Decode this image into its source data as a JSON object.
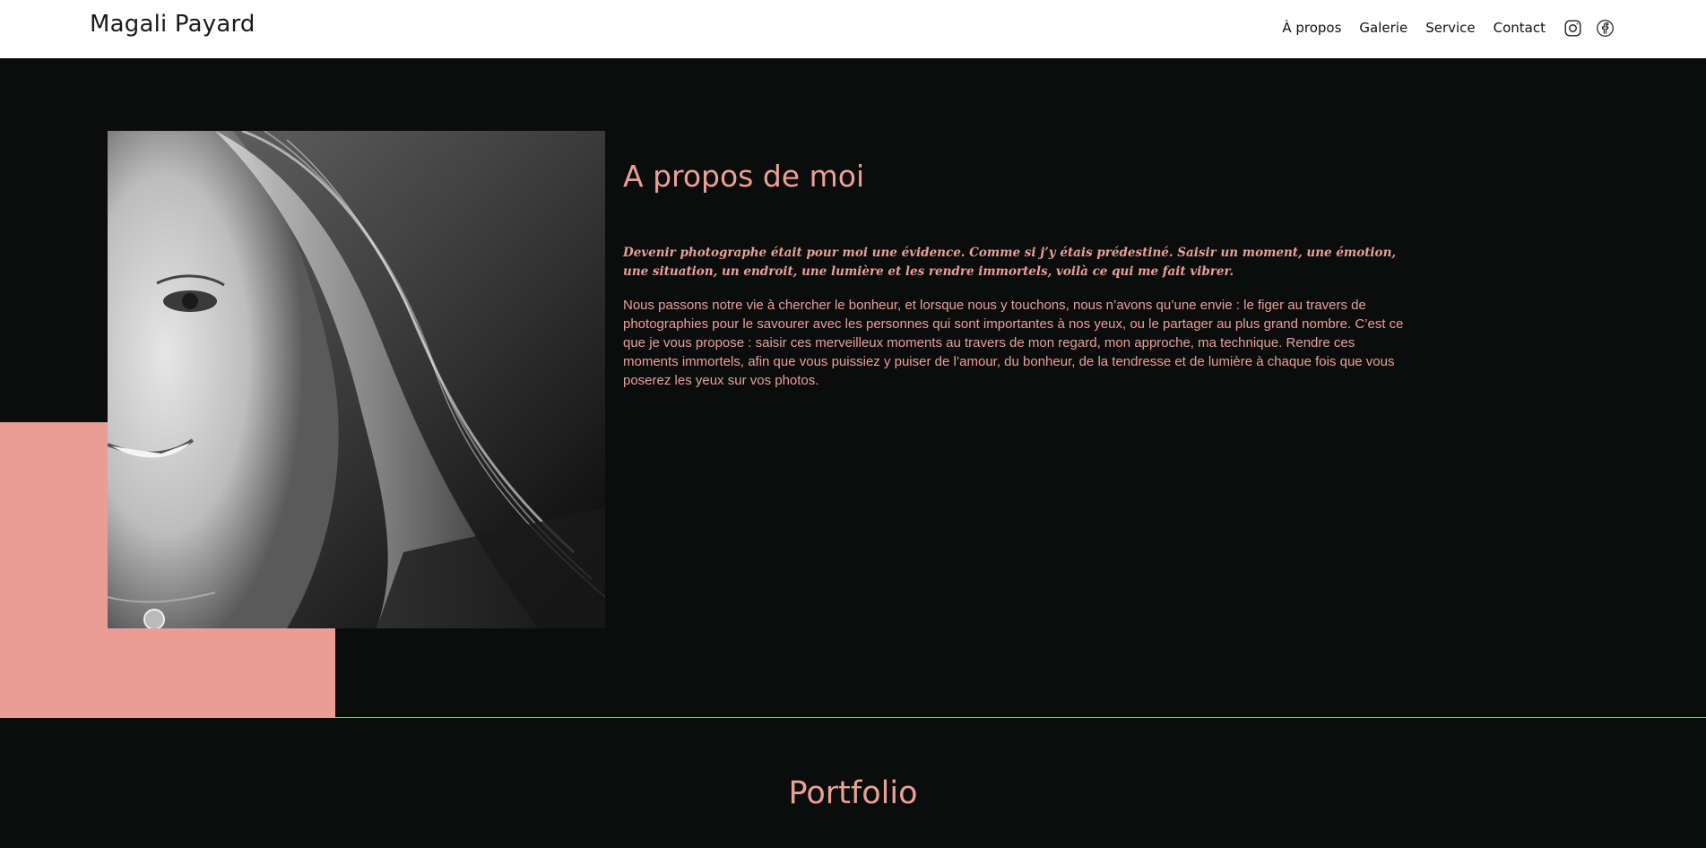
{
  "header": {
    "brand": "Magali Payard",
    "nav": [
      {
        "label": "À propos"
      },
      {
        "label": "Galerie"
      },
      {
        "label": "Service"
      },
      {
        "label": "Contact"
      }
    ],
    "social": [
      {
        "icon": "instagram-icon"
      },
      {
        "icon": "facebook-icon"
      }
    ]
  },
  "about": {
    "title": "A propos de moi",
    "lead": "Devenir photographe était pour moi une évidence. Comme si j’y étais prédestiné. Saisir un moment, une émotion, une situation, un endroit, une lumière et les rendre immortels, voilà ce qui me fait vibrer.",
    "body": "Nous passons notre vie à chercher le bonheur, et lorsque nous y touchons, nous n’avons qu’une envie : le figer au travers de photographies pour le savourer avec les personnes qui sont importantes à nos yeux, ou le partager au plus grand nombre. C’est ce que je vous propose : saisir ces merveilleux moments au travers de mon regard, mon approche, ma technique. Rendre ces moments immortels, afin que vous puissiez y puiser de l’amour, du bonheur, de la tendresse et de lumière à chaque fois que vous poserez les yeux sur vos photos."
  },
  "portfolio": {
    "title": "Portfolio"
  },
  "colors": {
    "accent": "#e9a097",
    "pink_block": "#e89d95",
    "background": "#0b0c0c",
    "header_bg": "#ffffff"
  }
}
